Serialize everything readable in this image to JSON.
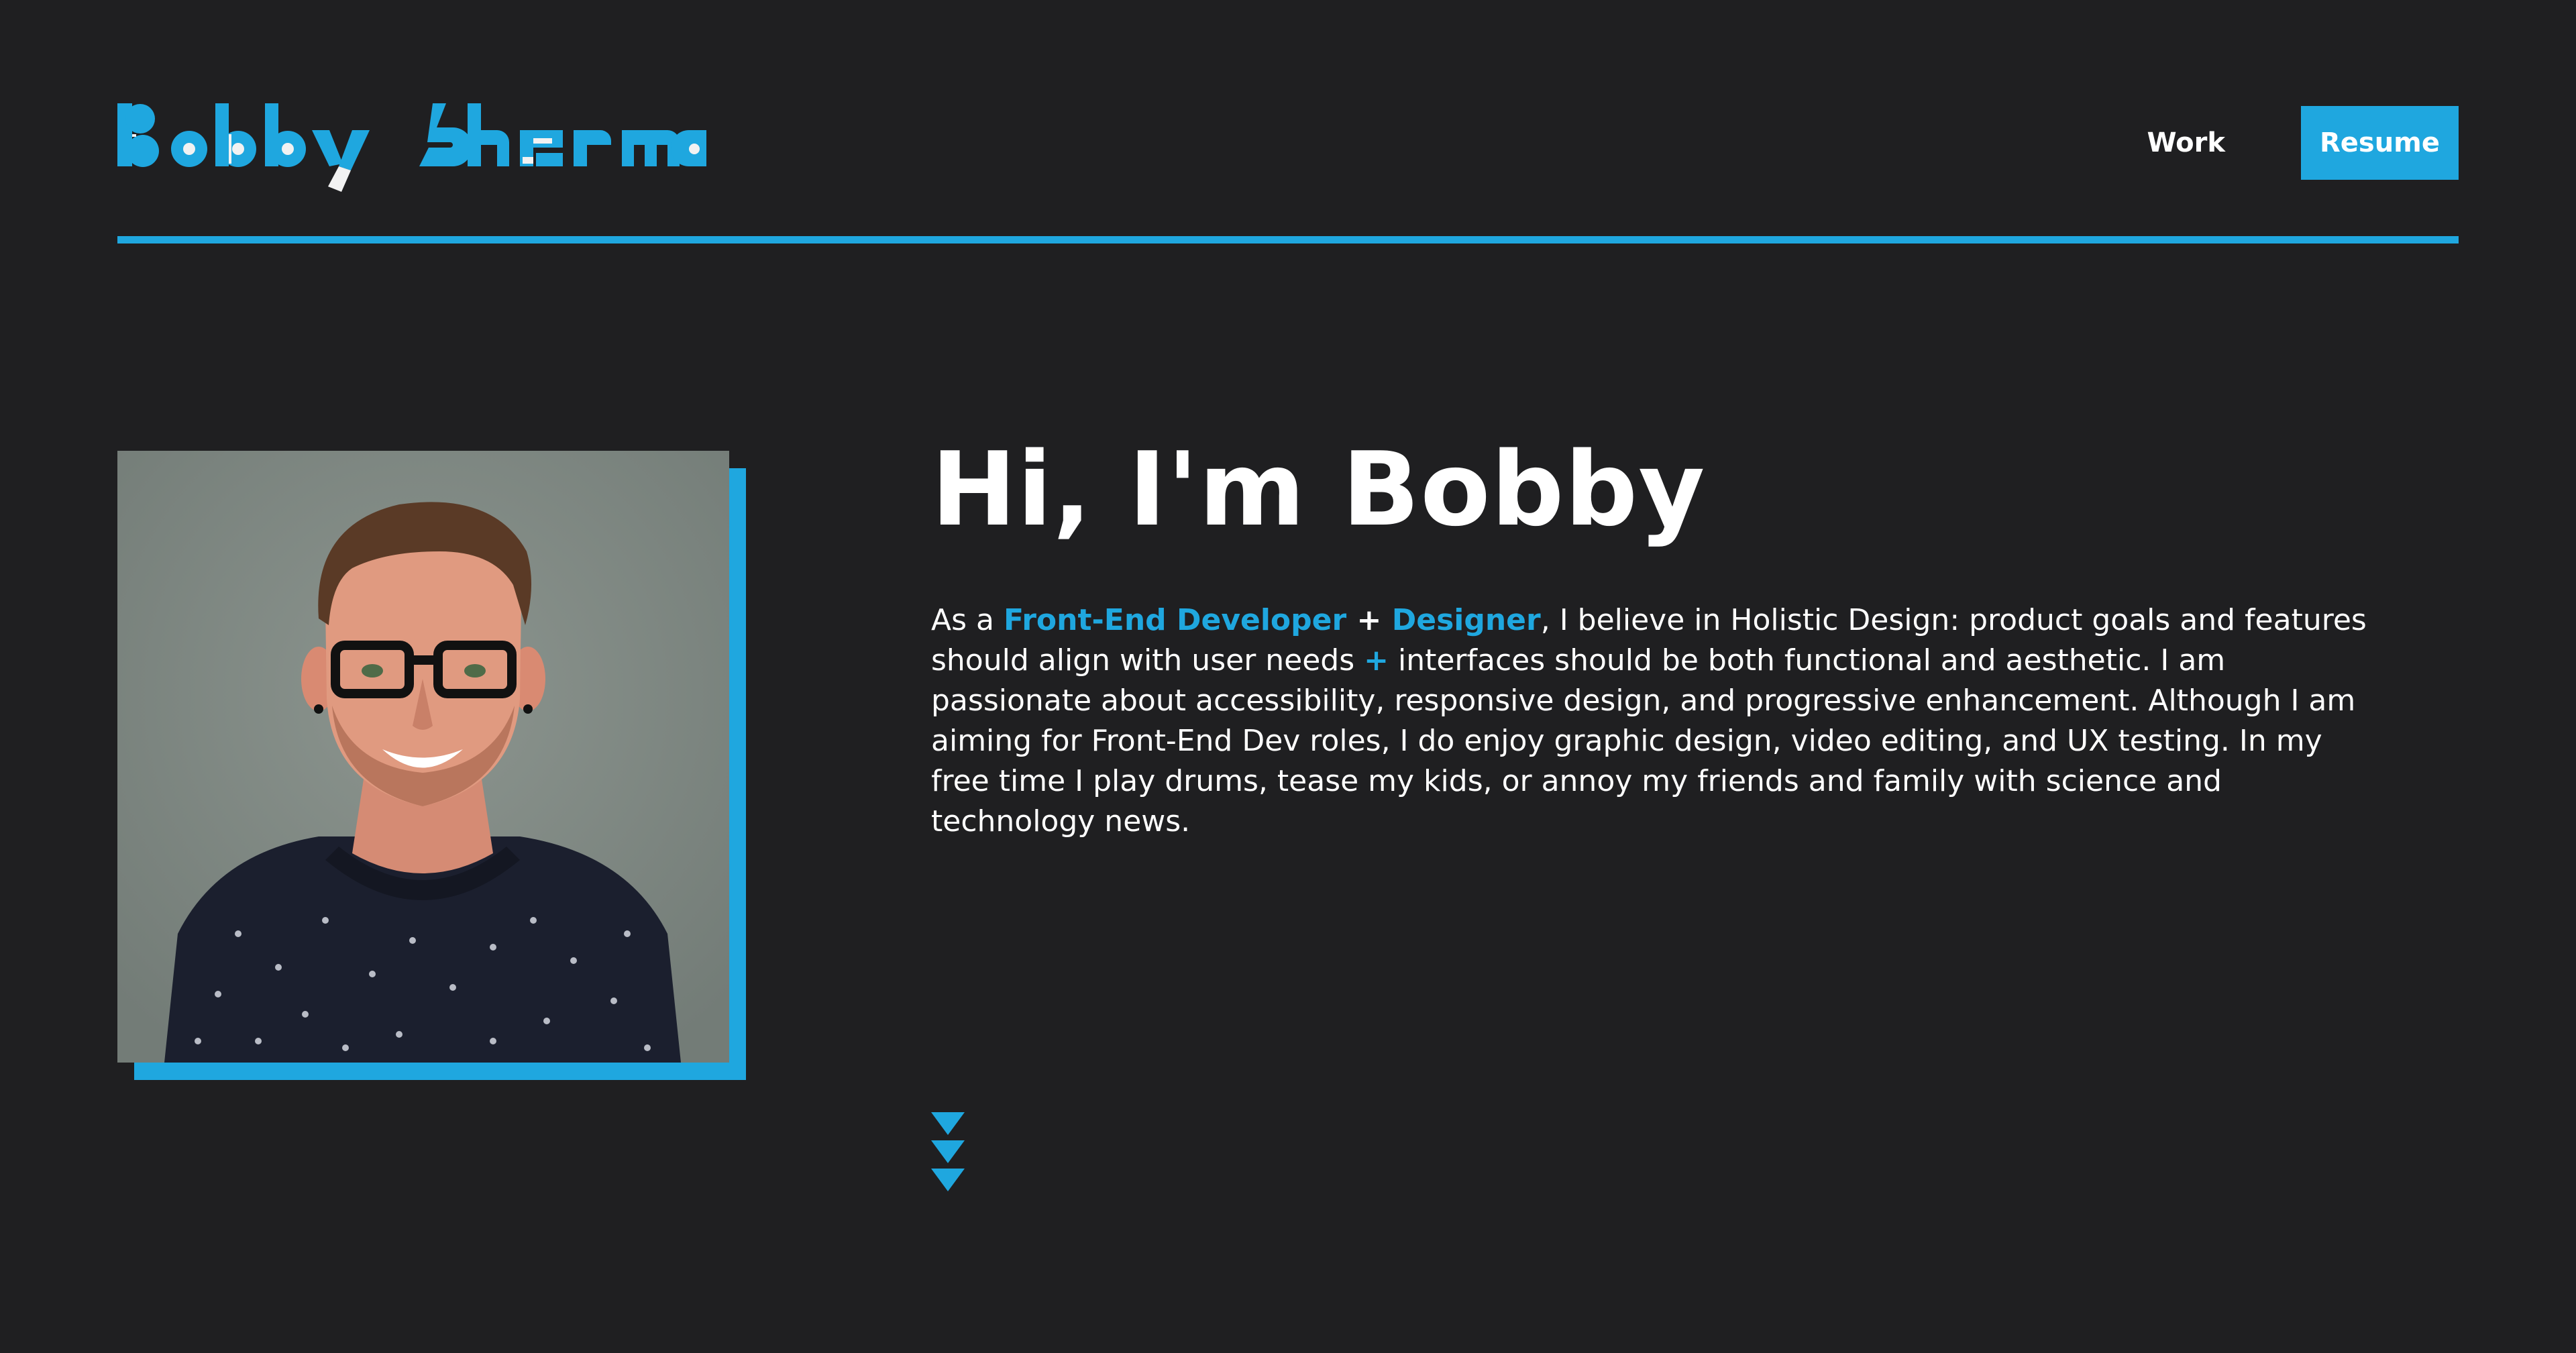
{
  "header": {
    "logo_text": "Bobby Sherman",
    "nav": {
      "work_label": "Work",
      "resume_label": "Resume"
    }
  },
  "hero": {
    "heading": "Hi, I'm Bobby",
    "paragraph": {
      "prefix": "As a ",
      "role1": "Front-End Developer",
      "plus1": " + ",
      "role2": "Designer",
      "middle1": ", I believe in Holistic Design: product goals and features should align with user needs ",
      "plus2": "+",
      "rest": " interfaces should be both functional and aesthetic. I am passionate about accessibility, responsive design, and progressive enhancement. Although I am aiming for Front-End Dev roles, I do enjoy graphic design, video editing, and UX testing. In my free time I play drums, tease my kids, or annoy my friends and family with science and technology news."
    }
  },
  "portrait": {
    "description_icon": "profile-photo"
  },
  "scroll_indicator": {
    "icon": "triple-chevron-down-icon"
  },
  "colors": {
    "background": "#1f1f21",
    "accent": "#1fa7df",
    "text": "#ffffff"
  }
}
